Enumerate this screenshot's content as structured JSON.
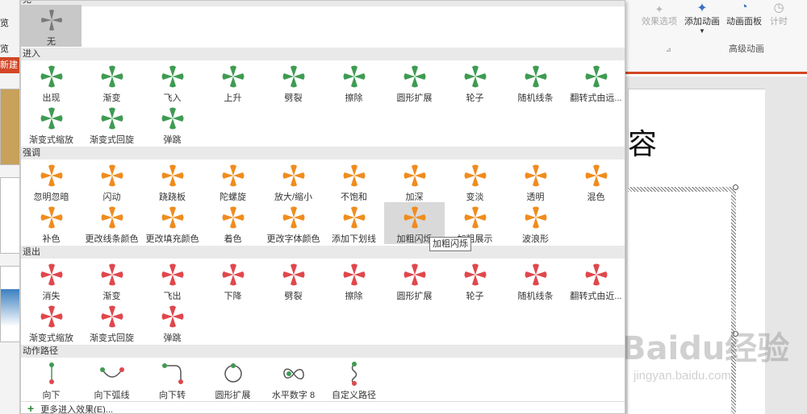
{
  "app": {
    "left_labels": [
      "览",
      "览"
    ],
    "new_button": "新建",
    "ribbon": {
      "effect_options": "效果选项",
      "add_animation": "添加动画",
      "animation_pane": "动画面板",
      "timing": "计时",
      "group_label": "高级动画"
    },
    "slide_title_fragment": "容",
    "accent_color": "#d24726"
  },
  "gallery": {
    "top_section": {
      "label": "无",
      "items": [
        {
          "label": "无",
          "icon": "none-star-icon"
        }
      ]
    },
    "sections": [
      {
        "label": "进入",
        "color": "#3f9b52",
        "rows": [
          [
            "出现",
            "渐变",
            "飞入",
            "上升",
            "劈裂",
            "擦除",
            "圆形扩展",
            "轮子",
            "随机线条",
            "翻转式由远..."
          ],
          [
            "渐变式缩放",
            "渐变式回旋",
            "弹跳"
          ]
        ]
      },
      {
        "label": "强调",
        "color": "#f08c1e",
        "rows": [
          [
            "忽明忽暗",
            "闪动",
            "跷跷板",
            "陀螺旋",
            "放大/缩小",
            "不饱和",
            "加深",
            "变淡",
            "透明",
            "混色"
          ],
          [
            "补色",
            "更改线条颜色",
            "更改填充颜色",
            "着色",
            "更改字体颜色",
            "添加下划线",
            "加粗闪烁",
            "加粗展示",
            "波浪形"
          ]
        ],
        "hovered": "加粗闪烁"
      },
      {
        "label": "退出",
        "color": "#e0474c",
        "rows": [
          [
            "消失",
            "渐变",
            "飞出",
            "下降",
            "劈裂",
            "擦除",
            "圆形扩展",
            "轮子",
            "随机线条",
            "翻转式由近..."
          ],
          [
            "渐变式缩放",
            "渐变式回旋",
            "弹跳"
          ]
        ]
      },
      {
        "label": "动作路径",
        "color": "#3f9b52",
        "rows": [
          [
            "向下",
            "向下弧线",
            "向下转",
            "圆形扩展",
            "水平数字 8",
            "自定义路径"
          ]
        ]
      }
    ],
    "tooltip": "加粗闪烁",
    "more_effects": "更多进入效果(E)..."
  },
  "watermark": {
    "brand": "Baidu经验",
    "url": "jingyan.baidu.com"
  }
}
